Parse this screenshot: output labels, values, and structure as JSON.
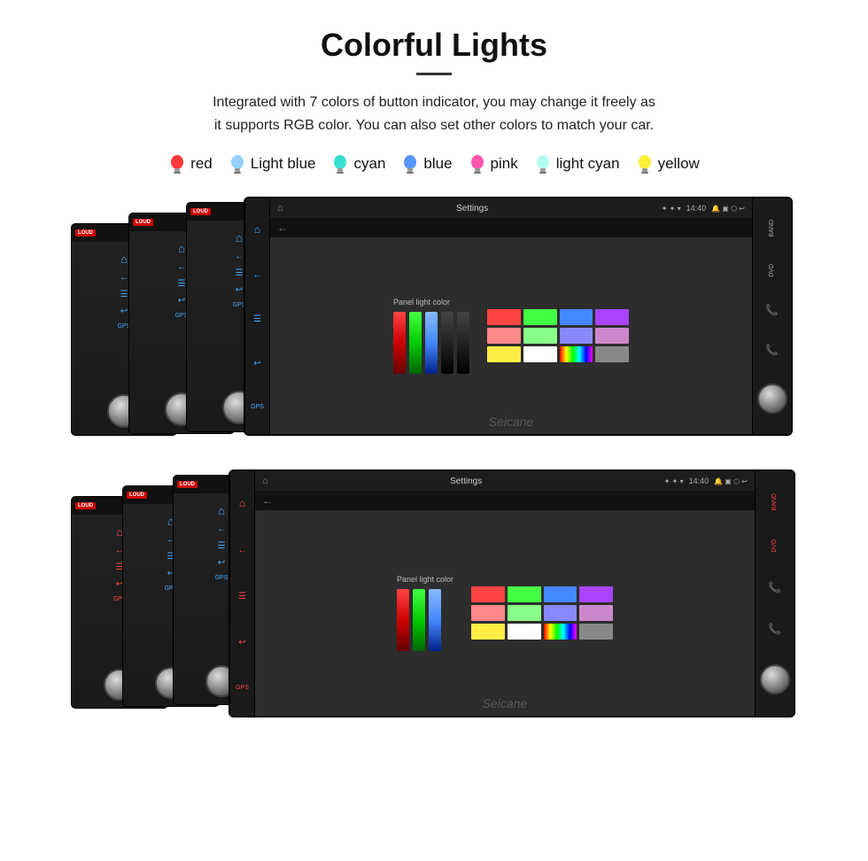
{
  "page": {
    "title": "Colorful Lights",
    "description": "Integrated with 7 colors of button indicator, you may change it freely as\nit supports RGB color. You can also set other colors to match your car.",
    "colors": [
      {
        "name": "red",
        "color": "#ff2222",
        "bulbColor": "#ff2222"
      },
      {
        "name": "Light blue",
        "color": "#88ccff",
        "bulbColor": "#88ccff"
      },
      {
        "name": "cyan",
        "color": "#22ddcc",
        "bulbColor": "#22ddcc"
      },
      {
        "name": "blue",
        "color": "#4488ff",
        "bulbColor": "#4488ff"
      },
      {
        "name": "pink",
        "color": "#ff44aa",
        "bulbColor": "#ff44aa"
      },
      {
        "name": "light cyan",
        "color": "#aaffee",
        "bulbColor": "#aaffee"
      },
      {
        "name": "yellow",
        "color": "#ffee22",
        "bulbColor": "#ffee22"
      }
    ],
    "panels": {
      "watermark": "Seicane",
      "status_time": "14:40",
      "settings_title": "Settings",
      "panel_light_color": "Panel light color",
      "top_group": {
        "units": [
          {
            "indicator": "#4488ff"
          },
          {
            "indicator": "#4488ff"
          },
          {
            "indicator": "#ffcc00"
          }
        ]
      },
      "bottom_group": {
        "units": [
          {
            "indicator": "#ff4444"
          },
          {
            "indicator": "#44ff44"
          },
          {
            "indicator": "#4488ff"
          },
          {
            "indicator": "#ff4444"
          }
        ]
      },
      "color_bars_top": [
        {
          "color": "#cc0000",
          "gradient": "linear-gradient(to bottom, #ff4444, #cc0000, #660000)"
        },
        {
          "color": "#00cc00",
          "gradient": "linear-gradient(to bottom, #44ff44, #00cc00, #006600)"
        },
        {
          "color": "#4488ff",
          "gradient": "linear-gradient(to bottom, #88bbff, #4488ff, #002288)"
        },
        {
          "color": "#111111",
          "gradient": "linear-gradient(to bottom, #444, #222, #000)"
        },
        {
          "color": "#111111",
          "gradient": "linear-gradient(to bottom, #444, #222, #000)"
        }
      ],
      "swatches_top": [
        "#ff4444",
        "#44ff44",
        "#4488ff",
        "#aa44ff",
        "#ff8888",
        "#88ff88",
        "#8888ff",
        "#cc88cc",
        "#ffee44",
        "#ffffff",
        "linear-gradient(90deg,#f00,#ff0,#0f0,#0ff,#00f,#f0f)",
        "#888888"
      ],
      "color_bars_bottom": [
        {
          "color": "#cc0000",
          "gradient": "linear-gradient(to bottom, #ff4444, #cc0000, #660000)"
        },
        {
          "color": "#00cc00",
          "gradient": "linear-gradient(to bottom, #44ff44, #00cc00, #006600)"
        },
        {
          "color": "#4488ff",
          "gradient": "linear-gradient(to bottom, #88bbff, #4488ff, #002288)"
        }
      ]
    }
  }
}
